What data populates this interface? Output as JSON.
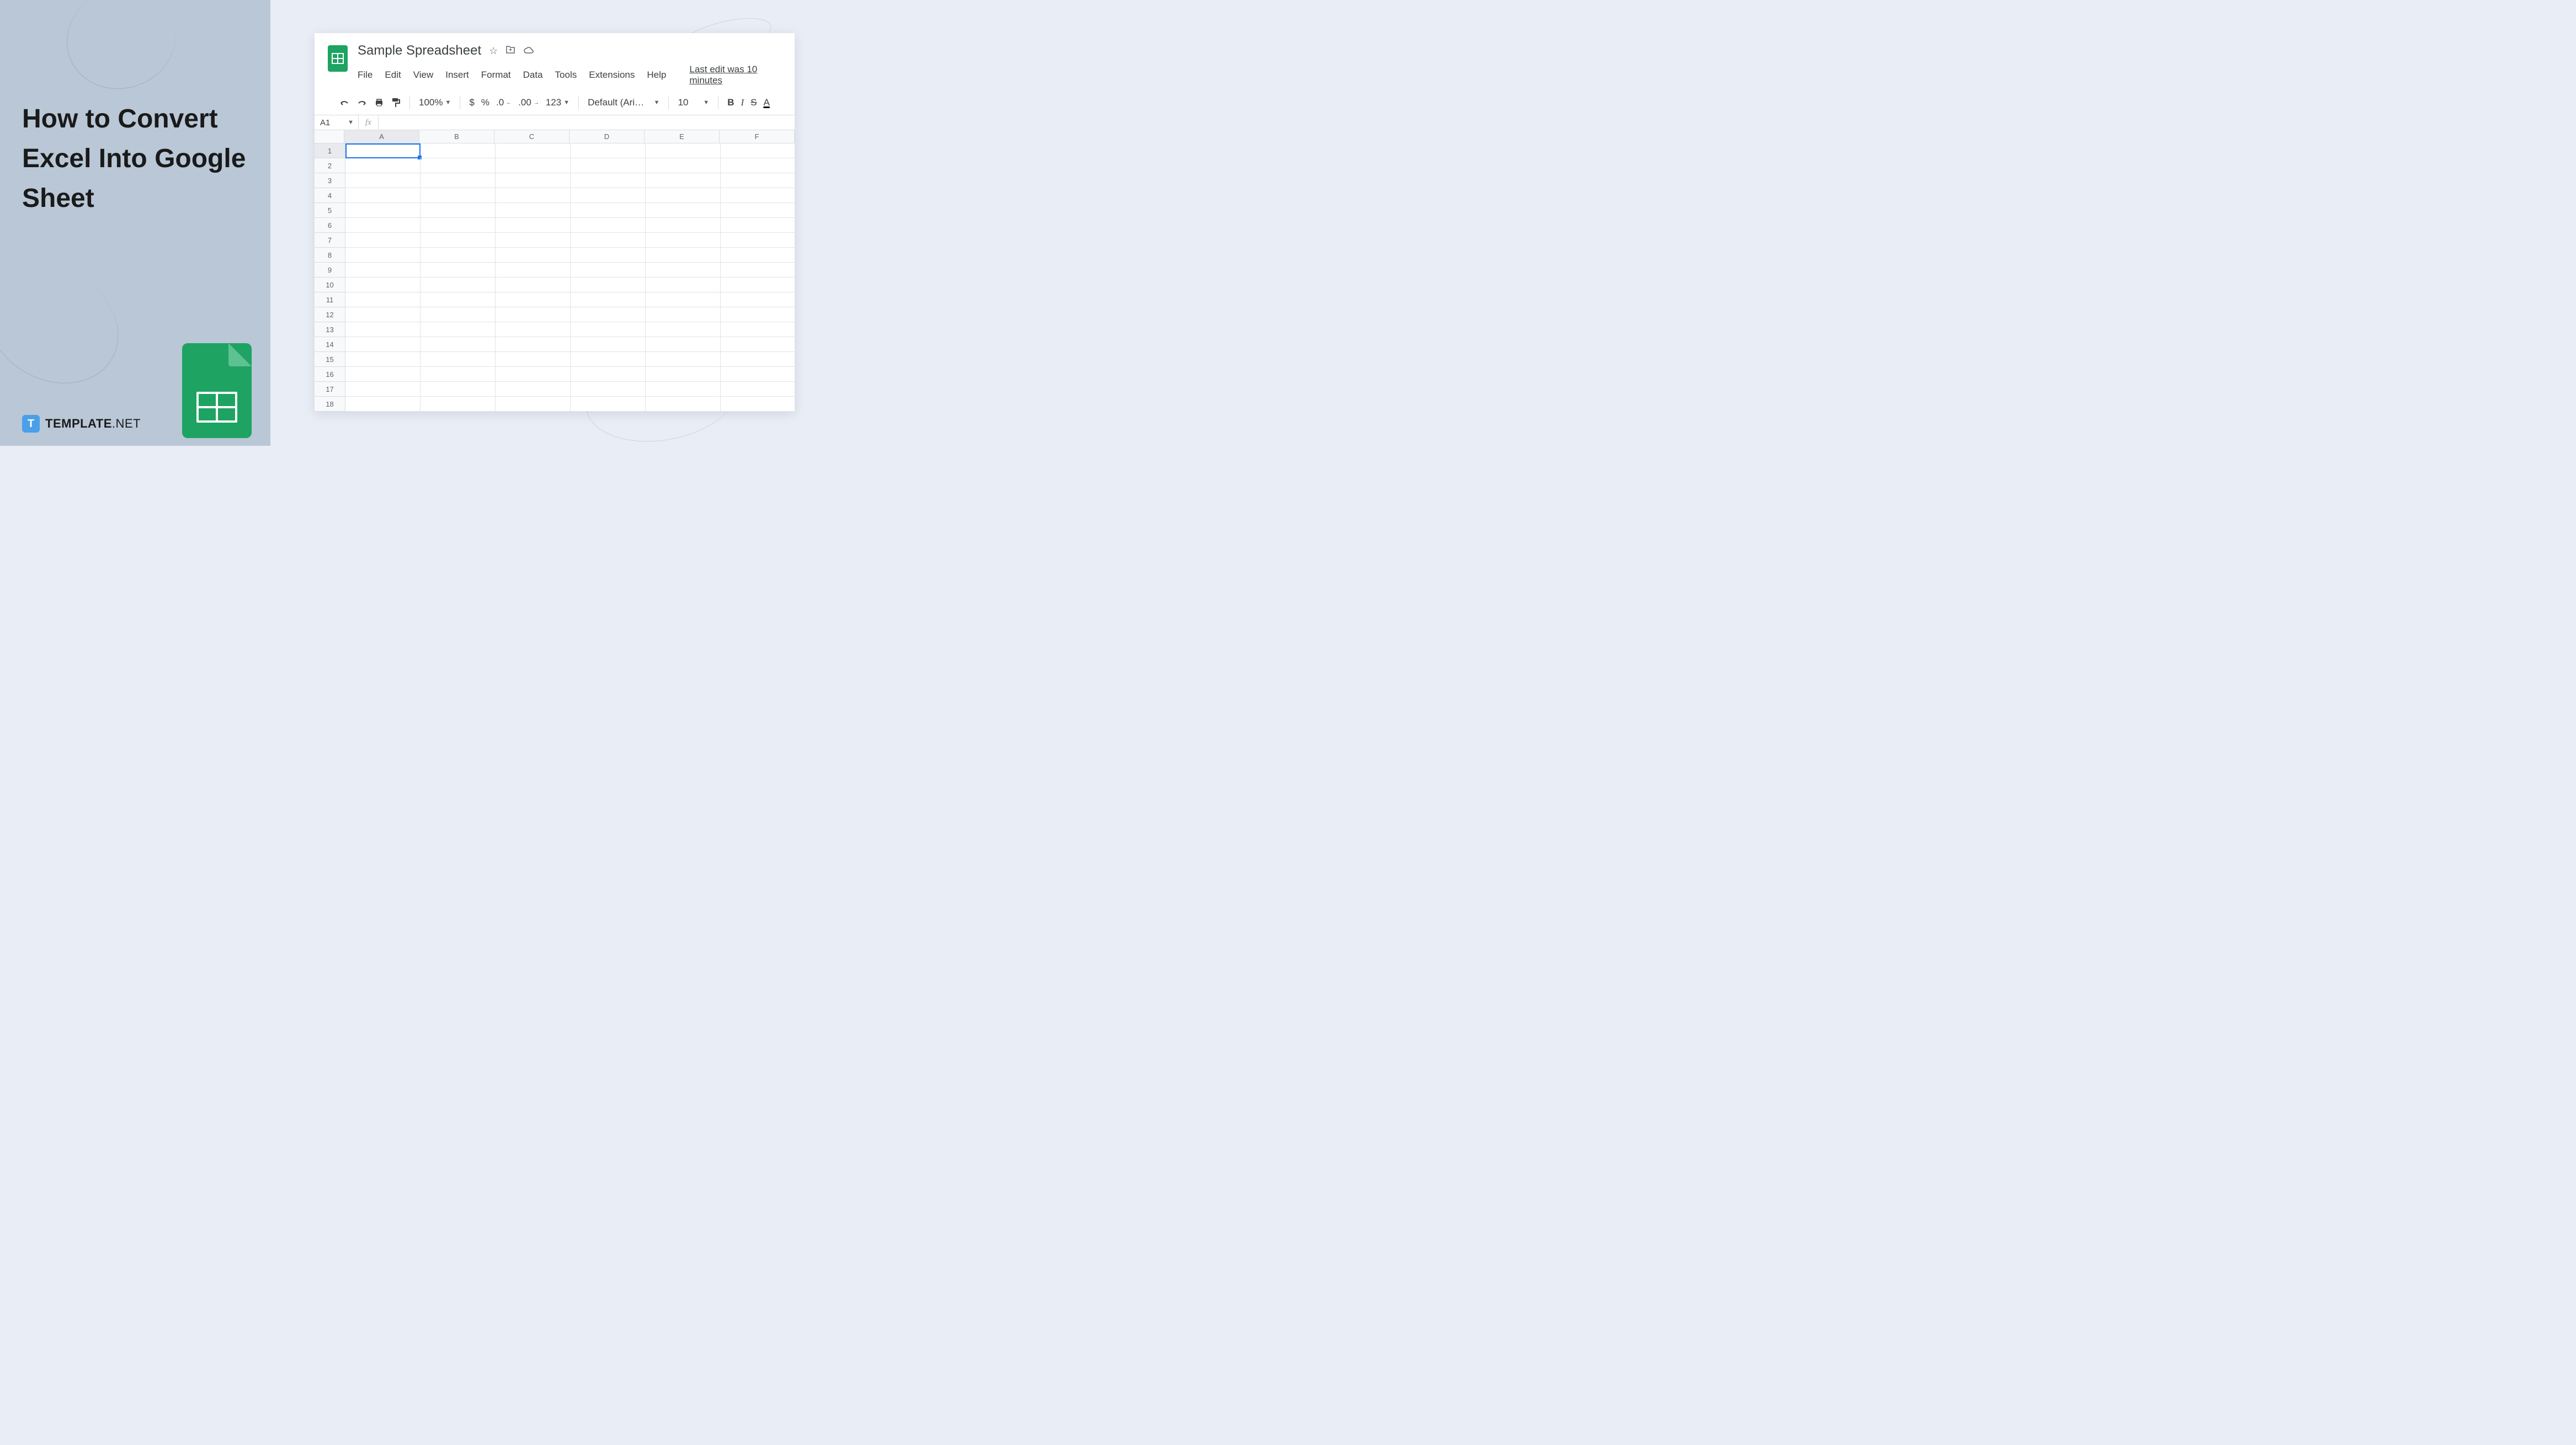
{
  "headline": "How to Convert Excel Into Google Sheet",
  "brand": {
    "name": "TEMPLATE",
    "suffix": ".NET",
    "icon_letter": "T"
  },
  "app": {
    "doc_title": "Sample Spreadsheet",
    "menus": [
      "File",
      "Edit",
      "View",
      "Insert",
      "Format",
      "Data",
      "Tools",
      "Extensions",
      "Help"
    ],
    "last_edit": "Last edit was 10 minutes",
    "toolbar": {
      "zoom": "100%",
      "currency": "$",
      "percent": "%",
      "dec_decrease": ".0",
      "dec_increase": ".00",
      "format_more": "123",
      "font": "Default (Ari…",
      "font_size": "10",
      "bold": "B",
      "italic": "I",
      "strike": "S",
      "text_color": "A"
    },
    "cell_ref": "A1",
    "fx_label": "fx",
    "columns": [
      "A",
      "B",
      "C",
      "D",
      "E",
      "F"
    ],
    "rows": [
      "1",
      "2",
      "3",
      "4",
      "5",
      "6",
      "7",
      "8",
      "9",
      "10",
      "11",
      "12",
      "13",
      "14",
      "15",
      "16",
      "17",
      "18"
    ],
    "selected_col": "A",
    "selected_row": "1"
  }
}
